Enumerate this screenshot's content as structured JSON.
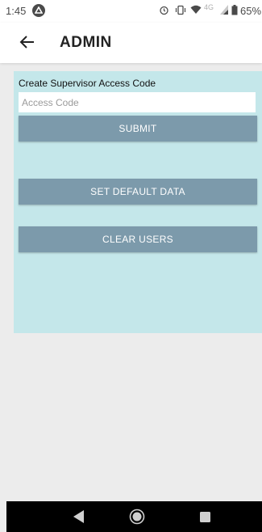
{
  "status_bar": {
    "time": "1:45",
    "network_label": "4G",
    "battery_percent": "65%"
  },
  "app_bar": {
    "title": "ADMIN"
  },
  "admin_panel": {
    "label": "Create Supervisor Access Code",
    "access_code_placeholder": "Access Code",
    "access_code_value": "",
    "submit_label": "SUBMIT",
    "set_default_label": "SET DEFAULT DATA",
    "clear_users_label": "CLEAR USERS"
  },
  "colors": {
    "panel_background": "#c4e7ea",
    "button_background": "#7c9aab",
    "page_background": "#ececec",
    "nav_bar": "#000000"
  },
  "icons": {
    "back": "arrow-left-icon",
    "alarm": "alarm-icon",
    "vibrate": "vibrate-icon",
    "wifi": "wifi-icon",
    "battery": "battery-icon"
  }
}
